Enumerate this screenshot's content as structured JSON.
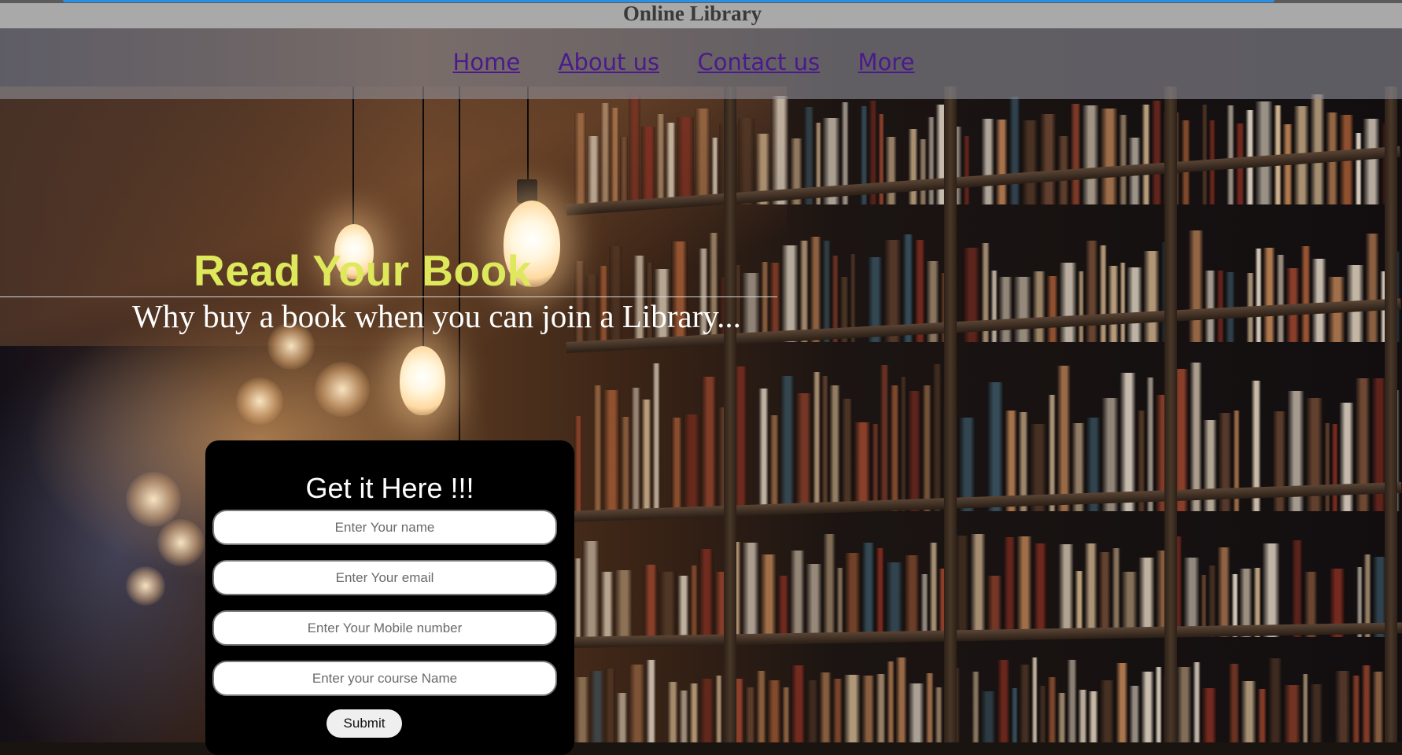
{
  "site": {
    "title": "Online Library"
  },
  "nav": {
    "items": [
      {
        "label": "Home"
      },
      {
        "label": "About us"
      },
      {
        "label": "Contact us"
      },
      {
        "label": "More"
      }
    ]
  },
  "hero": {
    "heading": "Read Your Book",
    "subheading": "Why buy a book when you can join a Library..."
  },
  "form": {
    "heading": "Get it Here !!!",
    "fields": [
      {
        "placeholder": "Enter Your name"
      },
      {
        "placeholder": "Enter Your email"
      },
      {
        "placeholder": "Enter Your Mobile number"
      },
      {
        "placeholder": "Enter your course Name"
      }
    ],
    "submit_label": "Submit"
  },
  "colors": {
    "heading_accent": "#dde85a",
    "nav_link": "#4b1a8c",
    "title_bar": "#a9a9a9",
    "form_background": "#000000"
  }
}
